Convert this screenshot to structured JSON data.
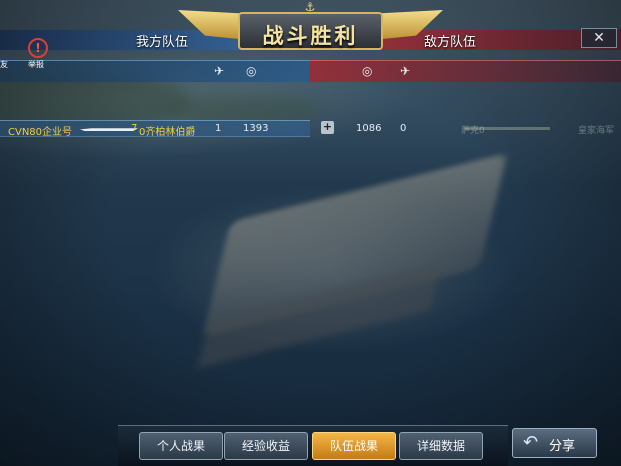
{
  "header": {
    "title": "战斗胜利",
    "our_team": "我方队伍",
    "enemy_team": "敌方队伍",
    "close": "✕"
  },
  "side": {
    "friend_label": "友",
    "report_label": "举报"
  },
  "row": {
    "ship_name": "CVN80企业号",
    "level": "7",
    "player": "0齐柏林伯爵",
    "kills": "1",
    "score": "1393",
    "plus": "+",
    "enemy_score": "1086",
    "enemy_kills": "0",
    "enemy_name": "萨克0",
    "enemy_team": "皇家海军"
  },
  "tabs": {
    "personal": "个人战果",
    "exp": "经验收益",
    "team": "队伍战果",
    "detail": "详细数据"
  },
  "share": {
    "label": "分享"
  },
  "colors": {
    "gold": "#f3cf3a",
    "active_tab": "#e89a2b",
    "our_team": "#3c6ea6",
    "enemy_team": "#a8323f"
  },
  "icons": [
    "anchor-icon",
    "plane-icon",
    "target-icon",
    "report-icon",
    "close-icon",
    "share-arrow-icon",
    "plus-icon"
  ]
}
